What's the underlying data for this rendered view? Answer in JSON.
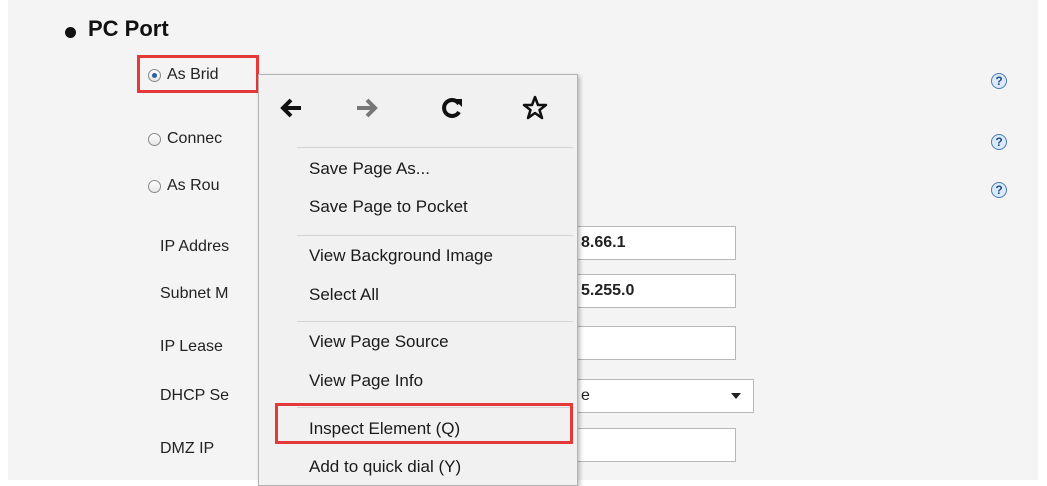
{
  "section": {
    "title": "PC Port"
  },
  "options": {
    "bridge": "As Brid",
    "connect": "Connec",
    "router": "As Rou"
  },
  "fields": {
    "ip_address": {
      "label": "IP Addres",
      "value": "8.66.1"
    },
    "subnet": {
      "label": "Subnet M",
      "value": "5.255.0"
    },
    "ip_lease": {
      "label": "IP Lease",
      "value": ""
    },
    "dhcp": {
      "label": "DHCP Se",
      "value": "e"
    },
    "dmz": {
      "label": "DMZ IP",
      "value": ""
    }
  },
  "help": {
    "symbol": "?"
  },
  "context_menu": {
    "items": [
      "Save Page As...",
      "Save Page to Pocket",
      "View Background Image",
      "Select All",
      "View Page Source",
      "View Page Info",
      "Inspect Element (Q)",
      "Add to quick dial (Y)"
    ],
    "nav_icons": [
      "back-arrow-icon",
      "forward-arrow-icon",
      "reload-icon",
      "bookmark-star-icon"
    ]
  },
  "colors": {
    "highlight": "#e53939",
    "menu_bg": "#f1f1f1",
    "panel_bg": "#f4f4f4"
  }
}
